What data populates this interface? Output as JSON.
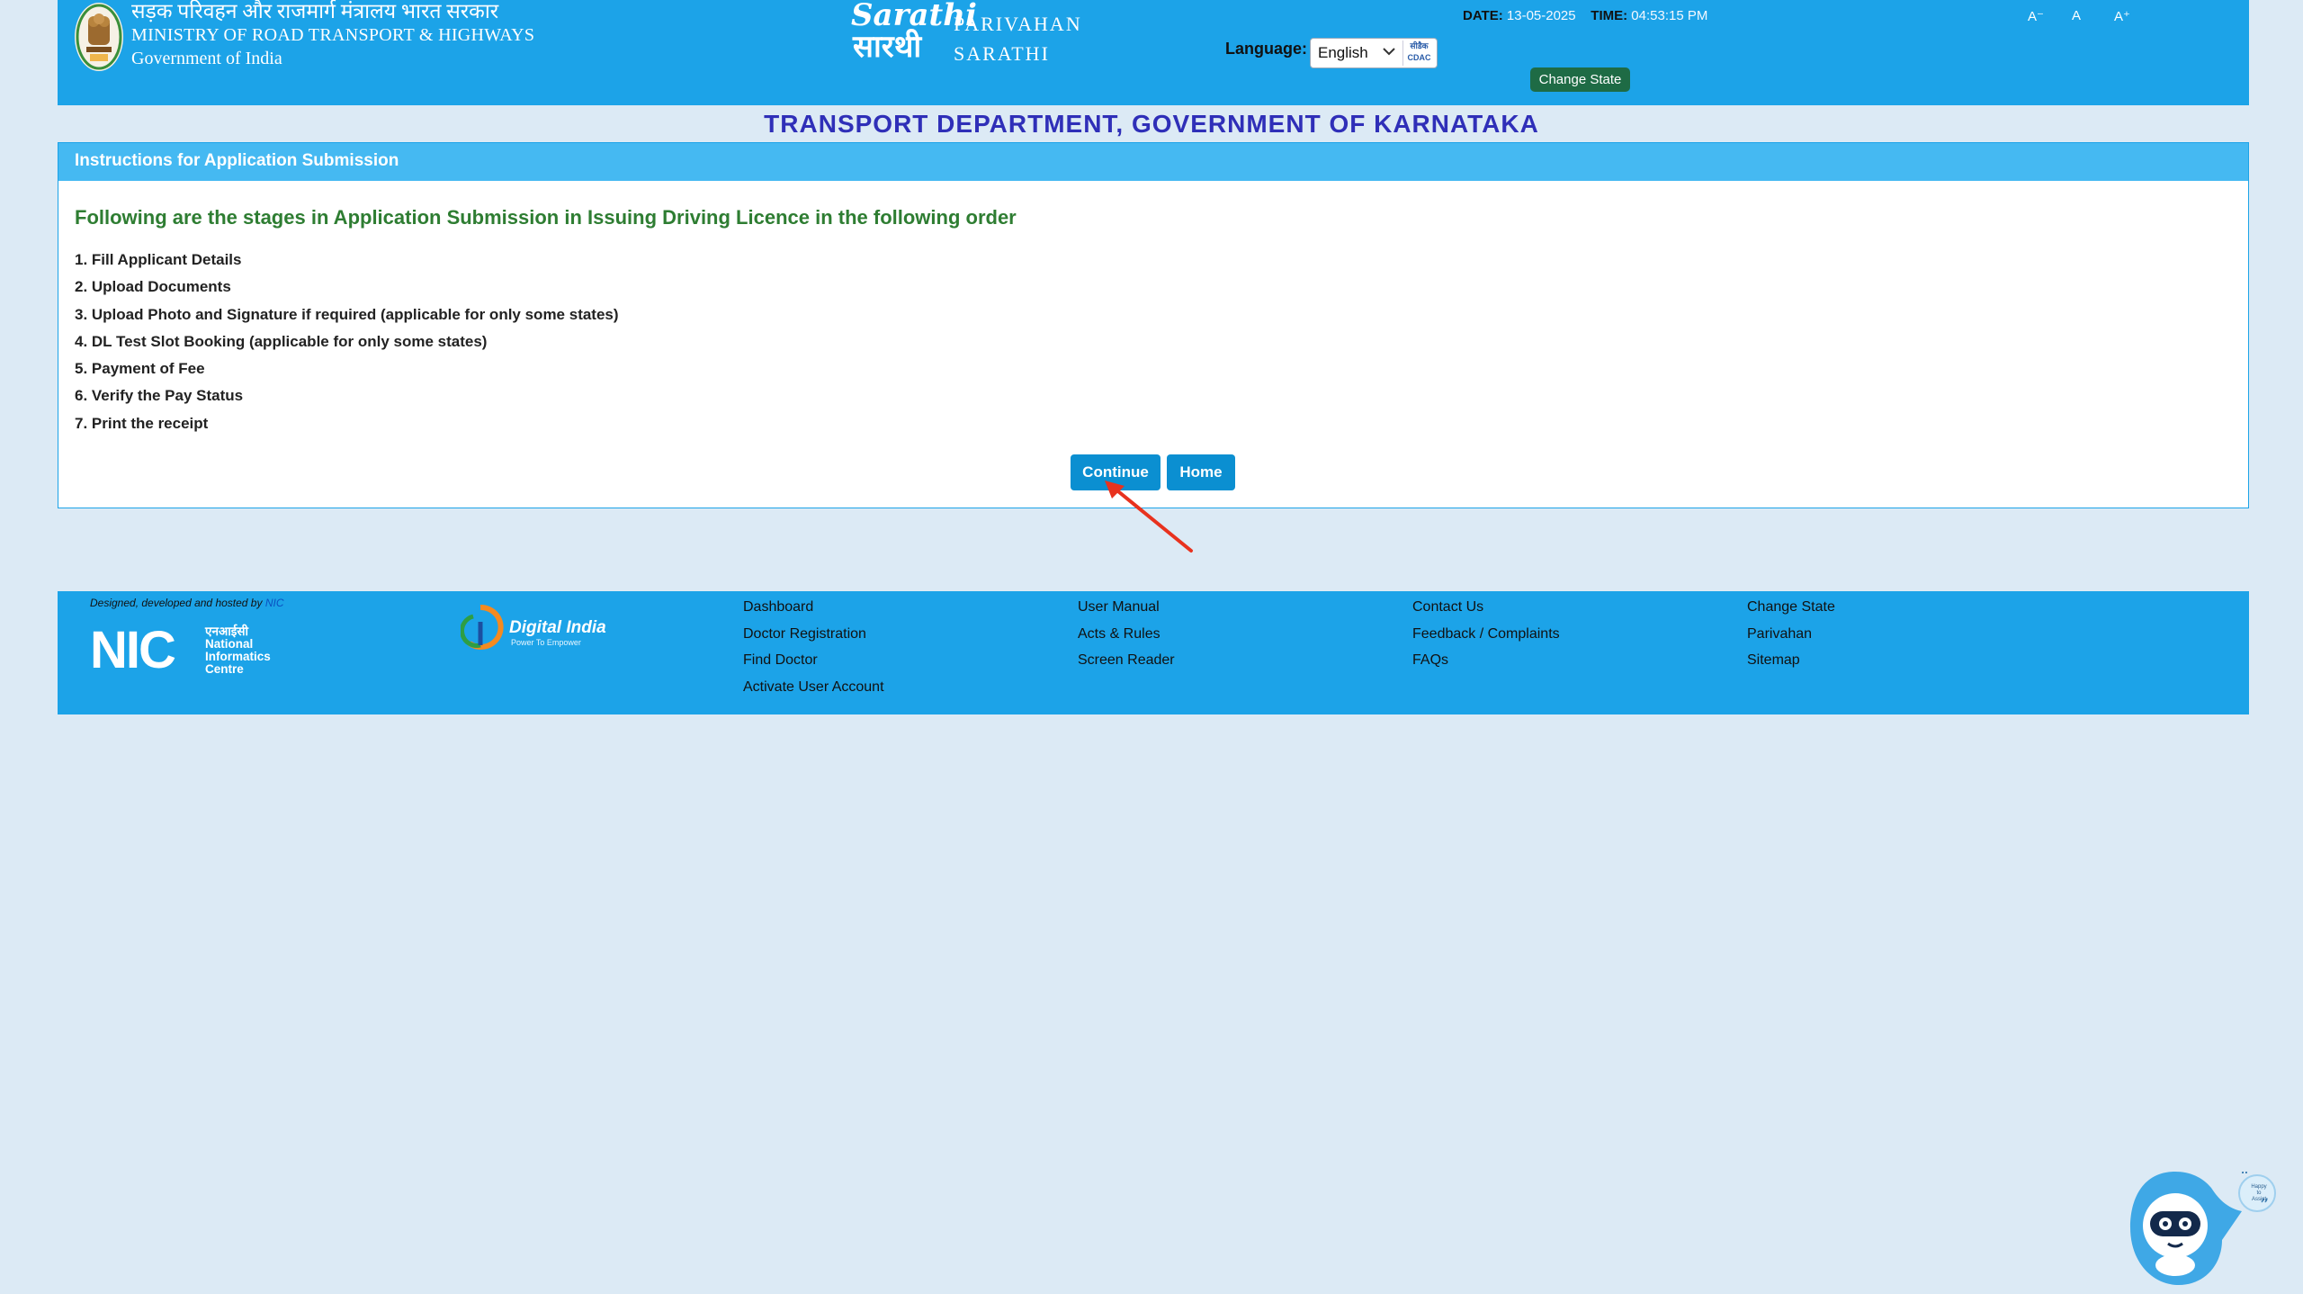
{
  "header": {
    "ministry_hindi": "सड़क परिवहन और राजमार्ग मंत्रालय भारत सरकार",
    "ministry_english": "MINISTRY OF ROAD TRANSPORT & HIGHWAYS",
    "government": "Government of India",
    "logo_script": "Sarathi",
    "logo_script_hindi": "सारथी",
    "logo_line1": "PARIVAHAN",
    "logo_line2": "SARATHI",
    "language_label": "Language:",
    "language_value": "English",
    "language_badge": "सीडैक CDAC",
    "date_label": "DATE:",
    "date_value": "13-05-2025",
    "time_label": "TIME:",
    "time_value": "04:53:15 PM",
    "font_decrease": "A⁻",
    "font_normal": "A",
    "font_increase": "A⁺",
    "change_state": "Change State"
  },
  "department_title": "TRANSPORT DEPARTMENT, GOVERNMENT OF KARNATAKA",
  "panel": {
    "heading": "Instructions for Application Submission",
    "subtitle": "Following are the stages in Application Submission in Issuing Driving Licence in the following order",
    "steps": [
      "1. Fill Applicant Details",
      "2. Upload Documents",
      "3. Upload Photo and Signature if required (applicable for only some states)",
      "4. DL Test Slot Booking (applicable for only some states)",
      "5. Payment of Fee",
      "6. Verify the Pay Status",
      "7. Print the receipt"
    ],
    "continue_label": "Continue",
    "home_label": "Home"
  },
  "footer": {
    "designed_text": "Designed, developed and hosted by",
    "designed_org": "NIC",
    "nic_logo_text": "NIC",
    "nic_hindi": "एनआईसी",
    "nic_line1": "National",
    "nic_line2": "Informatics",
    "nic_line3": "Centre",
    "digital_india": "Digital India",
    "digital_india_tag": "Power To Empower",
    "col1": [
      "Dashboard",
      "Doctor Registration",
      "Find Doctor",
      "Activate User Account"
    ],
    "col2": [
      "User Manual",
      "Acts & Rules",
      "Screen Reader"
    ],
    "col3": [
      "Contact Us",
      "Feedback / Complaints",
      "FAQs"
    ],
    "col4": [
      "Change State",
      "Parivahan",
      "Sitemap"
    ]
  },
  "chatbot": {
    "bubble_text": "Happy to Assist"
  },
  "colors": {
    "header_blue": "#1ca3e8",
    "panel_head": "#45b9f2",
    "button_blue": "#0b8fd1",
    "change_state_green": "#1e6b45",
    "title_blue": "#2f2fb8",
    "subtitle_green": "#2e7d32",
    "page_bg": "#dceaf5",
    "annotation_arrow": "#e8321e"
  },
  "icons": [
    "national-emblem-icon",
    "chevron-down-icon",
    "nic-logo-icon",
    "digital-india-icon",
    "chatbot-icon",
    "annotation-arrow-icon"
  ]
}
